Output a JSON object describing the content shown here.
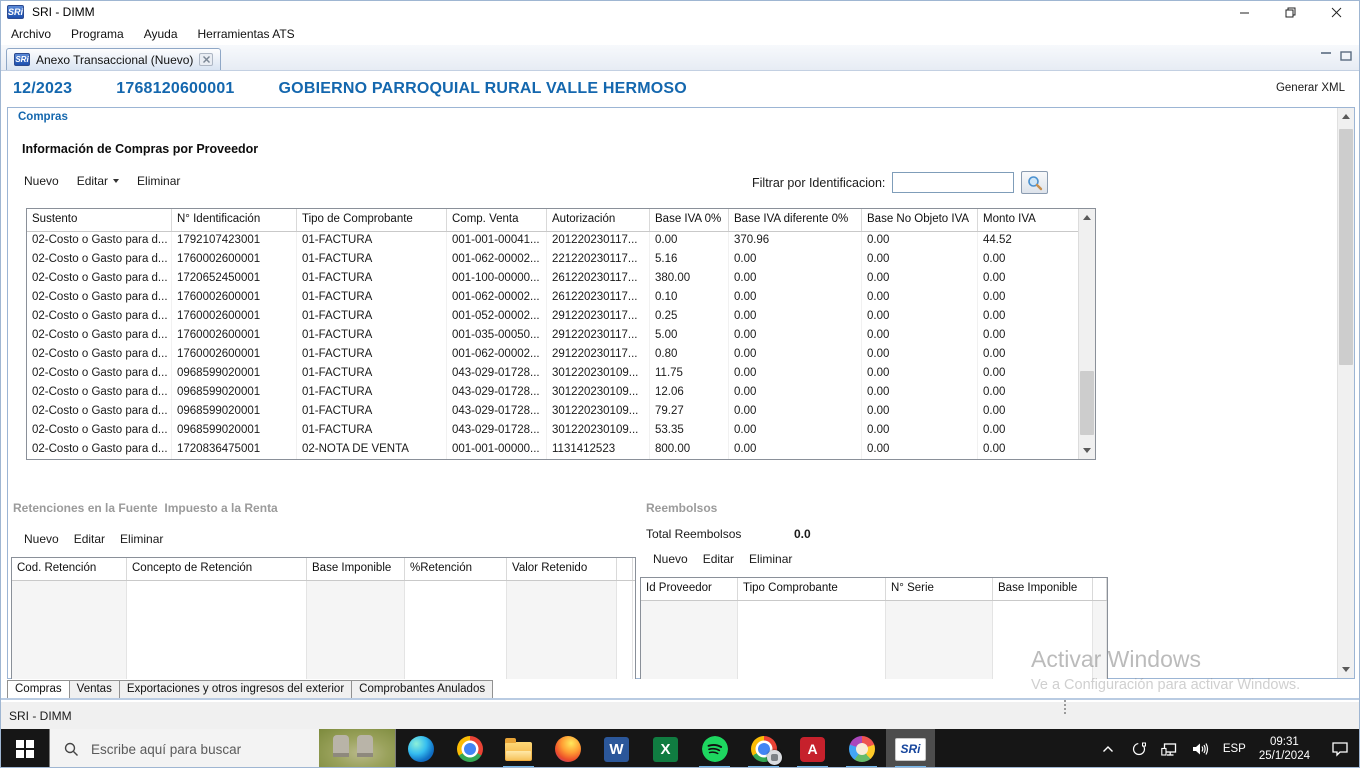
{
  "window": {
    "title": "SRI - DIMM",
    "logo_text": "SRi",
    "menu": [
      "Archivo",
      "Programa",
      "Ayuda",
      "Herramientas ATS"
    ],
    "tab_label": "Anexo Transaccional (Nuevo)"
  },
  "header": {
    "period": "12/2023",
    "ruc": "1768120600001",
    "entity": "GOBIERNO PARROQUIAL RURAL VALLE HERMOSO",
    "generate_xml": "Generar XML"
  },
  "compras": {
    "group_label": "Compras",
    "section_title": "Información de Compras por Proveedor",
    "toolbar": {
      "nuevo": "Nuevo",
      "editar": "Editar",
      "eliminar": "Eliminar"
    },
    "filter": {
      "label": "Filtrar por Identificacion:",
      "value": ""
    },
    "table": {
      "columns": [
        "Sustento",
        "N° Identificación",
        "Tipo de Comprobante",
        "Comp. Venta",
        "Autorización",
        "Base IVA 0%",
        "Base IVA diferente 0%",
        "Base No Objeto IVA",
        "Monto IVA"
      ],
      "rows": [
        [
          "02-Costo o Gasto para d...",
          "1792107423001",
          "01-FACTURA",
          "001-001-00041...",
          "201220230117...",
          "0.00",
          "370.96",
          "0.00",
          "44.52"
        ],
        [
          "02-Costo o Gasto para d...",
          "1760002600001",
          "01-FACTURA",
          "001-062-00002...",
          "221220230117...",
          "5.16",
          "0.00",
          "0.00",
          "0.00"
        ],
        [
          "02-Costo o Gasto para d...",
          "1720652450001",
          "01-FACTURA",
          "001-100-00000...",
          "261220230117...",
          "380.00",
          "0.00",
          "0.00",
          "0.00"
        ],
        [
          "02-Costo o Gasto para d...",
          "1760002600001",
          "01-FACTURA",
          "001-062-00002...",
          "261220230117...",
          "0.10",
          "0.00",
          "0.00",
          "0.00"
        ],
        [
          "02-Costo o Gasto para d...",
          "1760002600001",
          "01-FACTURA",
          "001-052-00002...",
          "291220230117...",
          "0.25",
          "0.00",
          "0.00",
          "0.00"
        ],
        [
          "02-Costo o Gasto para d...",
          "1760002600001",
          "01-FACTURA",
          "001-035-00050...",
          "291220230117...",
          "5.00",
          "0.00",
          "0.00",
          "0.00"
        ],
        [
          "02-Costo o Gasto para d...",
          "1760002600001",
          "01-FACTURA",
          "001-062-00002...",
          "291220230117...",
          "0.80",
          "0.00",
          "0.00",
          "0.00"
        ],
        [
          "02-Costo o Gasto para d...",
          "0968599020001",
          "01-FACTURA",
          "043-029-01728...",
          "301220230109...",
          "11.75",
          "0.00",
          "0.00",
          "0.00"
        ],
        [
          "02-Costo o Gasto para d...",
          "0968599020001",
          "01-FACTURA",
          "043-029-01728...",
          "301220230109...",
          "12.06",
          "0.00",
          "0.00",
          "0.00"
        ],
        [
          "02-Costo o Gasto para d...",
          "0968599020001",
          "01-FACTURA",
          "043-029-01728...",
          "301220230109...",
          "79.27",
          "0.00",
          "0.00",
          "0.00"
        ],
        [
          "02-Costo o Gasto para d...",
          "0968599020001",
          "01-FACTURA",
          "043-029-01728...",
          "301220230109...",
          "53.35",
          "0.00",
          "0.00",
          "0.00"
        ],
        [
          "02-Costo o Gasto para d...",
          "1720836475001",
          "02-NOTA DE VENTA",
          "001-001-00000...",
          "1131412523",
          "800.00",
          "0.00",
          "0.00",
          "0.00"
        ]
      ]
    }
  },
  "retenciones": {
    "title": "Retenciones en la Fuente  Impuesto a la Renta",
    "toolbar": {
      "nuevo": "Nuevo",
      "editar": "Editar",
      "eliminar": "Eliminar"
    },
    "table": {
      "columns": [
        "Cod. Retención",
        "Concepto de Retención",
        "Base Imponible",
        "%Retención",
        "Valor Retenido",
        ""
      ],
      "rows": []
    }
  },
  "reembolsos": {
    "title": "Reembolsos",
    "total_label": "Total Reembolsos",
    "total_value": "0.0",
    "toolbar": {
      "nuevo": "Nuevo",
      "editar": "Editar",
      "eliminar": "Eliminar"
    },
    "table": {
      "columns": [
        "Id Proveedor",
        "Tipo Comprobante",
        "N° Serie",
        "Base Imponible",
        ""
      ],
      "rows": []
    }
  },
  "bottom_tabs": [
    "Compras",
    "Ventas",
    "Exportaciones y otros ingresos del exterior",
    "Comprobantes Anulados"
  ],
  "status_bar": "SRI - DIMM",
  "watermark": {
    "line1": "Activar Windows",
    "line2": "Ve a Configuración para activar Windows."
  },
  "taskbar": {
    "search_placeholder": "Escribe aquí para buscar",
    "apps": [
      {
        "id": "edge",
        "running": false,
        "active": false
      },
      {
        "id": "chrome",
        "running": false,
        "active": false
      },
      {
        "id": "folder",
        "running": true,
        "active": false
      },
      {
        "id": "firefox",
        "running": false,
        "active": false
      },
      {
        "id": "word",
        "running": false,
        "active": false
      },
      {
        "id": "excel",
        "running": false,
        "active": false
      },
      {
        "id": "spotify",
        "running": true,
        "active": false
      },
      {
        "id": "meet",
        "running": true,
        "active": false
      },
      {
        "id": "acrobat",
        "running": true,
        "active": false
      },
      {
        "id": "paint",
        "running": true,
        "active": false
      },
      {
        "id": "sri",
        "running": true,
        "active": true
      }
    ],
    "tray": {
      "lang": "ESP",
      "time": "09:31",
      "date": "25/1/2024"
    }
  },
  "colors": {
    "accent_blue": "#1467ae",
    "panel_border": "#9cb5d4",
    "taskbar_bg": "#161616",
    "running_underline": "#76b9ed",
    "watermark_gray": "#8c8c8c"
  }
}
